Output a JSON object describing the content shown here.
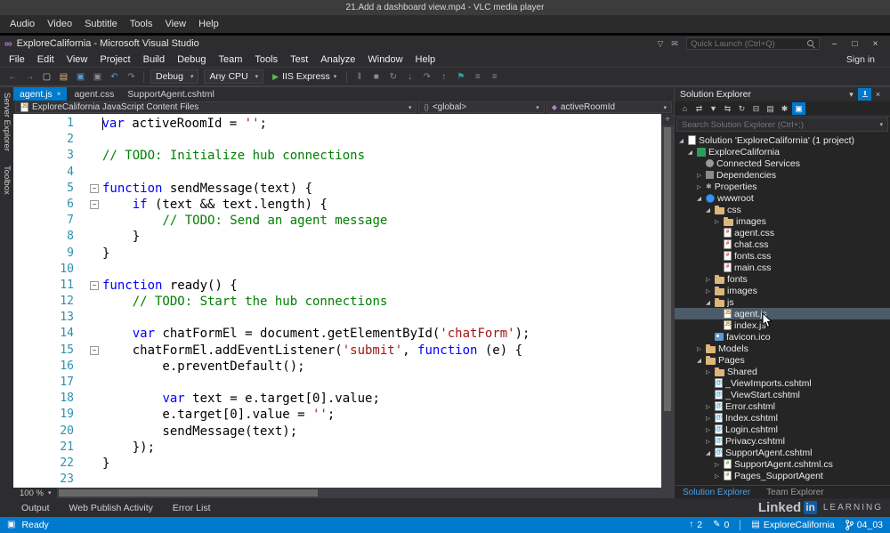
{
  "colors": {
    "accent": "#007acc",
    "keyword": "#0000ff",
    "comment": "#008000",
    "string": "#a31515",
    "line_number": "#2b91af",
    "run_green": "#58bc58",
    "folder": "#dcb67a"
  },
  "vlc": {
    "title": "21.Add a dashboard view.mp4 - VLC media player",
    "menus": [
      "Audio",
      "Video",
      "Subtitle",
      "Tools",
      "View",
      "Help"
    ]
  },
  "vs": {
    "title": "ExploreCalifornia - Microsoft Visual Studio",
    "sign_in": "Sign in",
    "quick_launch_placeholder": "Quick Launch (Ctrl+Q)",
    "titlebar_icons": [
      {
        "name": "filter-icon",
        "glyph": "▽"
      },
      {
        "name": "feedback-icon",
        "glyph": "✉"
      }
    ],
    "window_buttons": [
      {
        "name": "minimize-button",
        "glyph": "–"
      },
      {
        "name": "maximize-button",
        "glyph": "□"
      },
      {
        "name": "close-button",
        "glyph": "×"
      }
    ],
    "menus": [
      "File",
      "Edit",
      "View",
      "Project",
      "Build",
      "Debug",
      "Team",
      "Tools",
      "Test",
      "Analyze",
      "Window",
      "Help"
    ],
    "toolbar": {
      "left_icons": [
        {
          "name": "navigate-back-icon",
          "glyph": "←",
          "color": "#4f9cd6"
        },
        {
          "name": "navigate-forward-icon",
          "glyph": "→",
          "color": "#8a8a8a"
        },
        {
          "name": "new-project-icon",
          "glyph": "▢",
          "color": "#c8c8c8"
        },
        {
          "name": "open-file-icon",
          "glyph": "▤",
          "color": "#dcb67a"
        },
        {
          "name": "save-icon",
          "glyph": "▣",
          "color": "#4f9cd6"
        },
        {
          "name": "save-all-icon",
          "glyph": "▣",
          "color": "#8a8a8a"
        },
        {
          "name": "undo-icon",
          "glyph": "↶",
          "color": "#4f9cd6"
        },
        {
          "name": "redo-icon",
          "glyph": "↷",
          "color": "#8a8a8a"
        }
      ],
      "config_value": "Debug",
      "platform_value": "Any CPU",
      "run_label": "IIS Express",
      "right_icons": [
        {
          "name": "pause-icon",
          "glyph": "‖",
          "color": "#8a8a8a"
        },
        {
          "name": "stop-icon",
          "glyph": "■",
          "color": "#8a8a8a"
        },
        {
          "name": "restart-icon",
          "glyph": "↻",
          "color": "#8a8a8a"
        },
        {
          "name": "step-into-icon",
          "glyph": "↓",
          "color": "#8a8a8a"
        },
        {
          "name": "step-over-icon",
          "glyph": "↷",
          "color": "#8a8a8a"
        },
        {
          "name": "step-out-icon",
          "glyph": "↑",
          "color": "#8a8a8a"
        },
        {
          "name": "bookmark-icon",
          "glyph": "⚑",
          "color": "#3a9aa0"
        },
        {
          "name": "comment-icon",
          "glyph": "≡",
          "color": "#8a8a8a"
        },
        {
          "name": "uncomment-icon",
          "glyph": "≡",
          "color": "#8a8a8a"
        }
      ]
    },
    "side_strip": [
      "Server Explorer",
      "Toolbox"
    ],
    "editor": {
      "tabs": [
        {
          "label": "agent.js",
          "active": true
        },
        {
          "label": "agent.css",
          "active": false
        },
        {
          "label": "SupportAgent.cshtml",
          "active": false
        }
      ],
      "breadcrumb": [
        {
          "label": "ExploreCalifornia JavaScript Content Files",
          "icon": "jsfile"
        },
        {
          "label": "<global>",
          "icon": "global"
        },
        {
          "label": "activeRoomId",
          "icon": "field"
        }
      ],
      "zoom_value": "100 %",
      "fold_lines": [
        5,
        6,
        11,
        15
      ],
      "code_lines": [
        [
          [
            "kw",
            "var"
          ],
          [
            "pl",
            " activeRoomId = "
          ],
          [
            "str",
            "''"
          ],
          [
            "pl",
            ";"
          ]
        ],
        [],
        [
          [
            "cm",
            "// TODO: Initialize hub connections"
          ]
        ],
        [],
        [
          [
            "kw",
            "function"
          ],
          [
            "pl",
            " sendMessage(text) {"
          ]
        ],
        [
          [
            "pl",
            "    "
          ],
          [
            "kw",
            "if"
          ],
          [
            "pl",
            " (text && text.length) {"
          ]
        ],
        [
          [
            "pl",
            "        "
          ],
          [
            "cm",
            "// TODO: Send an agent message"
          ]
        ],
        [
          [
            "pl",
            "    }"
          ]
        ],
        [
          [
            "pl",
            "}"
          ]
        ],
        [],
        [
          [
            "kw",
            "function"
          ],
          [
            "pl",
            " ready() {"
          ]
        ],
        [
          [
            "pl",
            "    "
          ],
          [
            "cm",
            "// TODO: Start the hub connections"
          ]
        ],
        [],
        [
          [
            "pl",
            "    "
          ],
          [
            "kw",
            "var"
          ],
          [
            "pl",
            " chatFormEl = document.getElementById("
          ],
          [
            "str",
            "'chatForm'"
          ],
          [
            "pl",
            ");"
          ]
        ],
        [
          [
            "pl",
            "    chatFormEl.addEventListener("
          ],
          [
            "str",
            "'submit'"
          ],
          [
            "pl",
            ", "
          ],
          [
            "kw",
            "function"
          ],
          [
            "pl",
            " (e) {"
          ]
        ],
        [
          [
            "pl",
            "        e.preventDefault();"
          ]
        ],
        [],
        [
          [
            "pl",
            "        "
          ],
          [
            "kw",
            "var"
          ],
          [
            "pl",
            " text = e.target[0].value;"
          ]
        ],
        [
          [
            "pl",
            "        e.target[0].value = "
          ],
          [
            "str",
            "''"
          ],
          [
            "pl",
            ";"
          ]
        ],
        [
          [
            "pl",
            "        sendMessage(text);"
          ]
        ],
        [
          [
            "pl",
            "    });"
          ]
        ],
        [
          [
            "pl",
            "}"
          ]
        ],
        []
      ]
    },
    "solution_explorer": {
      "title": "Solution Explorer",
      "title_icons": [
        {
          "name": "toolwindow-menu-icon",
          "glyph": "▾"
        },
        {
          "name": "pin-icon",
          "glyph": "pin",
          "highlight": true
        },
        {
          "name": "close-icon",
          "glyph": "×"
        }
      ],
      "toolbar_icons": [
        {
          "name": "home-icon",
          "glyph": "⌂"
        },
        {
          "name": "switch-views-icon",
          "glyph": "⇄"
        },
        {
          "name": "pending-filter-icon",
          "glyph": "▼"
        },
        {
          "name": "sync-with-active-document-icon",
          "glyph": "⇆"
        },
        {
          "name": "refresh-icon",
          "glyph": "↻"
        },
        {
          "name": "collapse-all-icon",
          "glyph": "⊟"
        },
        {
          "name": "show-all-files-icon",
          "glyph": "▤"
        },
        {
          "name": "properties-icon",
          "glyph": "✱"
        },
        {
          "name": "preview-selected-icon",
          "glyph": "▣",
          "highlight": true
        }
      ],
      "search_placeholder": "Search Solution Explorer (Ctrl+;)",
      "tree": [
        {
          "label": "Solution 'ExploreCalifornia' (1 project)",
          "level": 0,
          "icon": "solution",
          "expand": "open"
        },
        {
          "label": "ExploreCalifornia",
          "level": 1,
          "icon": "project",
          "expand": "open"
        },
        {
          "label": "Connected Services",
          "level": 2,
          "icon": "services",
          "expand": "none"
        },
        {
          "label": "Dependencies",
          "level": 2,
          "icon": "dependencies",
          "expand": "closed"
        },
        {
          "label": "Properties",
          "level": 2,
          "icon": "properties",
          "expand": "closed"
        },
        {
          "label": "wwwroot",
          "level": 2,
          "icon": "globe",
          "expand": "open"
        },
        {
          "label": "css",
          "level": 3,
          "icon": "folder",
          "expand": "open"
        },
        {
          "label": "images",
          "level": 4,
          "icon": "folder",
          "expand": "closed"
        },
        {
          "label": "agent.css",
          "level": 4,
          "icon": "css",
          "expand": "none"
        },
        {
          "label": "chat.css",
          "level": 4,
          "icon": "css",
          "expand": "none"
        },
        {
          "label": "fonts.css",
          "level": 4,
          "icon": "css",
          "expand": "none"
        },
        {
          "label": "main.css",
          "level": 4,
          "icon": "css",
          "expand": "none"
        },
        {
          "label": "fonts",
          "level": 3,
          "icon": "folder",
          "expand": "closed"
        },
        {
          "label": "images",
          "level": 3,
          "icon": "folder",
          "expand": "closed"
        },
        {
          "label": "js",
          "level": 3,
          "icon": "folder",
          "expand": "open"
        },
        {
          "label": "agent.js",
          "level": 4,
          "icon": "js",
          "expand": "none",
          "selected": true
        },
        {
          "label": "index.js",
          "level": 4,
          "icon": "js",
          "expand": "none"
        },
        {
          "label": "favicon.ico",
          "level": 3,
          "icon": "image",
          "expand": "none"
        },
        {
          "label": "Models",
          "level": 2,
          "icon": "folder",
          "expand": "closed"
        },
        {
          "label": "Pages",
          "level": 2,
          "icon": "folder",
          "expand": "open"
        },
        {
          "label": "Shared",
          "level": 3,
          "icon": "folder",
          "expand": "closed"
        },
        {
          "label": "_ViewImports.cshtml",
          "level": 3,
          "icon": "cshtml",
          "expand": "none"
        },
        {
          "label": "_ViewStart.cshtml",
          "level": 3,
          "icon": "cshtml",
          "expand": "none"
        },
        {
          "label": "Error.cshtml",
          "level": 3,
          "icon": "cshtml",
          "expand": "closed"
        },
        {
          "label": "Index.cshtml",
          "level": 3,
          "icon": "cshtml",
          "expand": "closed"
        },
        {
          "label": "Login.cshtml",
          "level": 3,
          "icon": "cshtml",
          "expand": "closed"
        },
        {
          "label": "Privacy.cshtml",
          "level": 3,
          "icon": "cshtml",
          "expand": "closed"
        },
        {
          "label": "SupportAgent.cshtml",
          "level": 3,
          "icon": "cshtml",
          "expand": "open"
        },
        {
          "label": "SupportAgent.cshtml.cs",
          "level": 4,
          "icon": "cs",
          "expand": "closed"
        },
        {
          "label": "Pages_SupportAgent",
          "level": 4,
          "icon": "cs",
          "expand": "closed"
        }
      ],
      "tabs": [
        {
          "label": "Solution Explorer",
          "active": true
        },
        {
          "label": "Team Explorer",
          "active": false
        }
      ]
    },
    "bottom_tabs": [
      "Output",
      "Web Publish Activity",
      "Error List"
    ],
    "status_bar": {
      "state": "Ready",
      "commits_ahead": "2",
      "pending_changes": "0",
      "repository": "ExploreCalifornia",
      "branch": "04_03"
    }
  },
  "watermark": {
    "part1": "Linked",
    "part2": "in",
    "part3": "LEARNING"
  }
}
